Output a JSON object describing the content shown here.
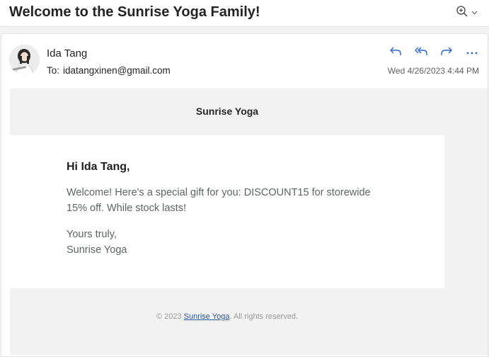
{
  "subject": "Welcome to the Sunrise Yoga Family!",
  "header": {
    "sender_name": "Ida Tang",
    "to_label": "To:",
    "to_address": "idatangxinen@gmail.com",
    "timestamp": "Wed 4/26/2023 4:44 PM",
    "actions": [
      "reply-icon",
      "reply-all-icon",
      "forward-icon",
      "more-icon"
    ],
    "accent_color": "#2b66c9"
  },
  "email": {
    "brand_header": "Sunrise Yoga",
    "greeting": "Hi Ida Tang,",
    "body": "Welcome! Here's a special gift for you: DISCOUNT15 for storewide 15% off. While stock lasts!",
    "signoff_line1": "Yours truly,",
    "signoff_line2": "Sunrise Yoga",
    "footer_prefix": "© 2023 ",
    "footer_link": "Sunrise Yoga",
    "footer_suffix": ". All rights reserved."
  }
}
